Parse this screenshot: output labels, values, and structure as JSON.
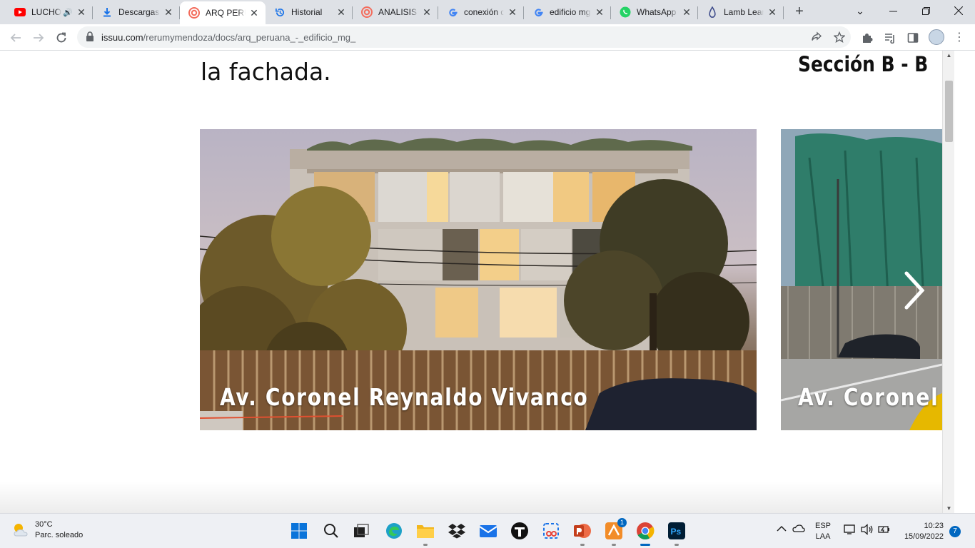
{
  "tabs": [
    {
      "title": "LUCHO",
      "favicon": "youtube-icon",
      "audio": true
    },
    {
      "title": "Descargas",
      "favicon": "download-icon"
    },
    {
      "title": "ARQ PERUANA",
      "favicon": "issuu-icon",
      "active": true
    },
    {
      "title": "Historial",
      "favicon": "history-icon"
    },
    {
      "title": "ANALISIS DE",
      "favicon": "issuu-icon"
    },
    {
      "title": "conexión de",
      "favicon": "google-icon"
    },
    {
      "title": "edificio mg",
      "favicon": "google-icon"
    },
    {
      "title": "WhatsApp",
      "favicon": "whatsapp-icon"
    },
    {
      "title": "Lamb Learn",
      "favicon": "lamb-icon"
    }
  ],
  "address": {
    "domain": "issuu.com",
    "path": "/rerumymendoza/docs/arq_peruana_-_edificio_mg_"
  },
  "page": {
    "heading_left": "la fachada.",
    "heading_right": "Sección B - B",
    "caption_1": "Av. Coronel Reynaldo Vivanco",
    "caption_2": "Av. Coronel Re"
  },
  "taskbar": {
    "weather_temp": "30°C",
    "weather_desc": "Parc. soleado",
    "lang_line1": "ESP",
    "lang_line2": "LAA",
    "time": "10:23",
    "date": "15/09/2022",
    "notifications": "7",
    "vpn_badge": "1"
  },
  "colors": {
    "tabstrip": "#dee1e6",
    "accent": "#0067c0",
    "youtube": "#ff0000",
    "issuu": "#f36d5d",
    "whatsapp": "#25d366"
  }
}
